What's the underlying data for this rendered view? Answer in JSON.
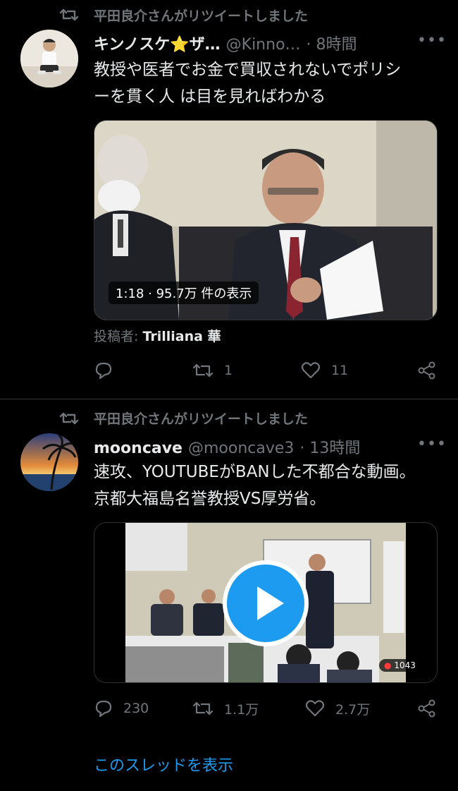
{
  "colors": {
    "accent": "#1d9bf0",
    "muted": "#71767b",
    "background": "#000000"
  },
  "tweets": [
    {
      "retweet_label": "平田良介さんがリツイートしました",
      "name": "キンノスケ⭐ザ…",
      "handle": "@Kinno…",
      "time": "· 8時間",
      "text": "教授や医者でお金で買収されないでポリシ\nーを貫く人 は目を見ればわかる",
      "video_overlay": "1:18 · 95.7万 件の表示",
      "credit_prefix": "投稿者: ",
      "credit_name": "Trilliana 華",
      "replies": "",
      "retweets": "1",
      "likes": "11"
    },
    {
      "retweet_label": "平田良介さんがリツイートしました",
      "name": "mooncave",
      "handle": "@mooncave3",
      "time": "· 13時間",
      "text": "速攻、YOUTUBEがBANした不都合な動画。\n京都大福島名誉教授VS厚労省。",
      "viewer_badge": "1043",
      "replies": "230",
      "retweets": "1.1万",
      "likes": "2.7万"
    }
  ],
  "show_thread": "このスレッドを表示"
}
